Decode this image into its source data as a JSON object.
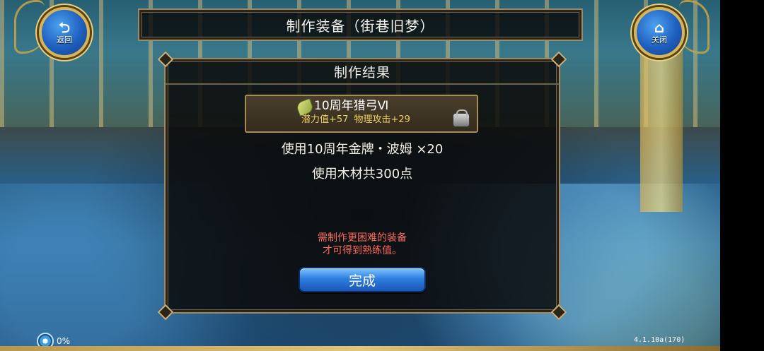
{
  "nav": {
    "back_label": "返回",
    "close_label": "关闭"
  },
  "title": "制作装备（街巷旧梦）",
  "panel": {
    "header": "制作结果",
    "item": {
      "name": "10周年猎弓Ⅵ",
      "stat_1": "潜力值+57",
      "stat_2": "物理攻击+29"
    },
    "use_line_1": "使用10周年金牌・波姆 ×20",
    "use_line_2": "使用木材共300点",
    "hint_line_1": "需制作更困难的装备",
    "hint_line_2": "才可得到熟练值。",
    "done_label": "完成"
  },
  "status": {
    "percent": "0%"
  },
  "version": "4.1.10a(170)",
  "colors": {
    "accent_gold": "#c9a445",
    "hint_red": "#ff6a5a",
    "stat_yellow": "#f0d060",
    "button_blue": "#2f7fe0"
  },
  "icons": {
    "back": "return-arrow-icon",
    "close": "home-icon",
    "item": "leaf-bow-icon",
    "craft": "anvil-icon",
    "status": "loading-ring-icon"
  }
}
